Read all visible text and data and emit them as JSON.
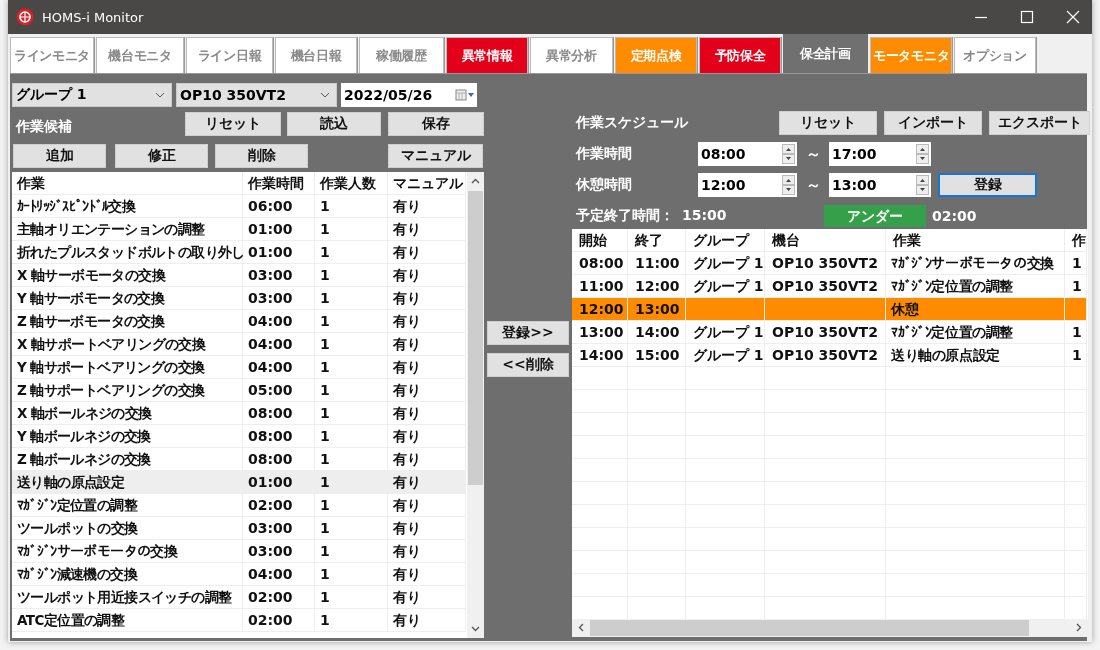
{
  "window": {
    "title": "HOMS-i Monitor"
  },
  "tabs": [
    {
      "label": "ラインモニタ",
      "selected": false,
      "color": "#ffffff"
    },
    {
      "label": "機台モニタ",
      "selected": false,
      "color": "#ffffff"
    },
    {
      "label": "ライン日報",
      "selected": false,
      "color": "#ffffff"
    },
    {
      "label": "機台日報",
      "selected": false,
      "color": "#ffffff"
    },
    {
      "label": "稼働履歴",
      "selected": false,
      "color": "#ffffff"
    },
    {
      "label": "異常情報",
      "selected": false,
      "color": "#e2001a"
    },
    {
      "label": "異常分析",
      "selected": false,
      "color": "#ffffff"
    },
    {
      "label": "定期点検",
      "selected": false,
      "color": "#ff8c00"
    },
    {
      "label": "予防保全",
      "selected": false,
      "color": "#e2001a"
    },
    {
      "label": "保全計画",
      "selected": true,
      "color": "#707070"
    },
    {
      "label": "モータモニタ",
      "selected": false,
      "color": "#ff8c00"
    },
    {
      "label": "オプション",
      "selected": false,
      "color": "#ffffff"
    }
  ],
  "filters": {
    "group": "グループ 1",
    "machine": "OP10 350VT2",
    "date": "2022/05/26"
  },
  "candidates": {
    "title": "作業候補",
    "file_buttons": [
      "リセット",
      "読込",
      "保存"
    ],
    "edit_buttons": [
      "追加",
      "修正",
      "削除"
    ],
    "manual_button": "マニュアル",
    "columns": [
      "作業",
      "作業時間",
      "作業人数",
      "マニュアル"
    ],
    "rows": [
      {
        "cells": [
          "ｶｰﾄﾘｯｼﾞｽﾋﾟﾝﾄﾞﾙ交換",
          "06:00",
          "1",
          "有り"
        ],
        "selected": false
      },
      {
        "cells": [
          "主軸オリエンテーションの調整",
          "01:00",
          "1",
          "有り"
        ],
        "selected": false
      },
      {
        "cells": [
          "折れたプルスタッドボルトの取り外し",
          "01:00",
          "1",
          "有り"
        ],
        "selected": false
      },
      {
        "cells": [
          "X 軸サーボモータの交換",
          "03:00",
          "1",
          "有り"
        ],
        "selected": false
      },
      {
        "cells": [
          "Y 軸サーボモータの交換",
          "03:00",
          "1",
          "有り"
        ],
        "selected": false
      },
      {
        "cells": [
          "Z 軸サーボモータの交換",
          "04:00",
          "1",
          "有り"
        ],
        "selected": false
      },
      {
        "cells": [
          "X 軸サポートベアリングの交換",
          "04:00",
          "1",
          "有り"
        ],
        "selected": false
      },
      {
        "cells": [
          "Y 軸サポートベアリングの交換",
          "04:00",
          "1",
          "有り"
        ],
        "selected": false
      },
      {
        "cells": [
          "Z 軸サポートベアリングの交換",
          "05:00",
          "1",
          "有り"
        ],
        "selected": false
      },
      {
        "cells": [
          "X 軸ボールネジの交換",
          "08:00",
          "1",
          "有り"
        ],
        "selected": false
      },
      {
        "cells": [
          "Y 軸ボールネジの交換",
          "08:00",
          "1",
          "有り"
        ],
        "selected": false
      },
      {
        "cells": [
          "Z 軸ボールネジの交換",
          "08:00",
          "1",
          "有り"
        ],
        "selected": false
      },
      {
        "cells": [
          "送り軸の原点設定",
          "01:00",
          "1",
          "有り"
        ],
        "selected": true
      },
      {
        "cells": [
          "ﾏｶﾞｼﾞﾝ定位置の調整",
          "02:00",
          "1",
          "有り"
        ],
        "selected": false
      },
      {
        "cells": [
          "ツールポットの交換",
          "03:00",
          "1",
          "有り"
        ],
        "selected": false
      },
      {
        "cells": [
          "ﾏｶﾞｼﾞﾝサーボモータの交換",
          "03:00",
          "1",
          "有り"
        ],
        "selected": false
      },
      {
        "cells": [
          "ﾏｶﾞｼﾞﾝ減速機の交換",
          "04:00",
          "1",
          "有り"
        ],
        "selected": false
      },
      {
        "cells": [
          "ツールポット用近接スイッチの調整",
          "02:00",
          "1",
          "有り"
        ],
        "selected": false
      },
      {
        "cells": [
          "ATC定位置の調整",
          "02:00",
          "1",
          "有り"
        ],
        "selected": false
      }
    ]
  },
  "transfer_buttons": [
    "登録>>",
    "<<削除"
  ],
  "schedule": {
    "title": "作業スケジュール",
    "buttons": [
      "リセット",
      "インポート",
      "エクスポート"
    ],
    "work_time": {
      "label": "作業時間",
      "start": "08:00",
      "separator": "～",
      "end": "17:00"
    },
    "break_time": {
      "label": "休憩時間",
      "start": "12:00",
      "separator": "～",
      "end": "13:00"
    },
    "register_button": "登録",
    "planned_end": {
      "label": "予定終了時間：",
      "value": "15:00"
    },
    "status": {
      "label": "アンダー",
      "color": "#34a14a"
    },
    "difference": "02:00",
    "columns": [
      "開始",
      "終了",
      "グループ",
      "機台",
      "作業",
      "作"
    ],
    "rows": [
      {
        "kind": "task",
        "cells": [
          "08:00",
          "11:00",
          "グループ 1",
          "OP10 350VT2",
          "ﾏｶﾞｼﾞﾝサーボモータの交換",
          "1"
        ]
      },
      {
        "kind": "task",
        "cells": [
          "11:00",
          "12:00",
          "グループ 1",
          "OP10 350VT2",
          "ﾏｶﾞｼﾞﾝ定位置の調整",
          "1"
        ]
      },
      {
        "kind": "break",
        "cells": [
          "12:00",
          "13:00",
          "",
          "",
          "休憩",
          ""
        ]
      },
      {
        "kind": "task",
        "cells": [
          "13:00",
          "14:00",
          "グループ 1",
          "OP10 350VT2",
          "ﾏｶﾞｼﾞﾝ定位置の調整",
          "1"
        ]
      },
      {
        "kind": "task",
        "cells": [
          "14:00",
          "15:00",
          "グループ 1",
          "OP10 350VT2",
          "送り軸の原点設定",
          "1"
        ]
      }
    ]
  }
}
